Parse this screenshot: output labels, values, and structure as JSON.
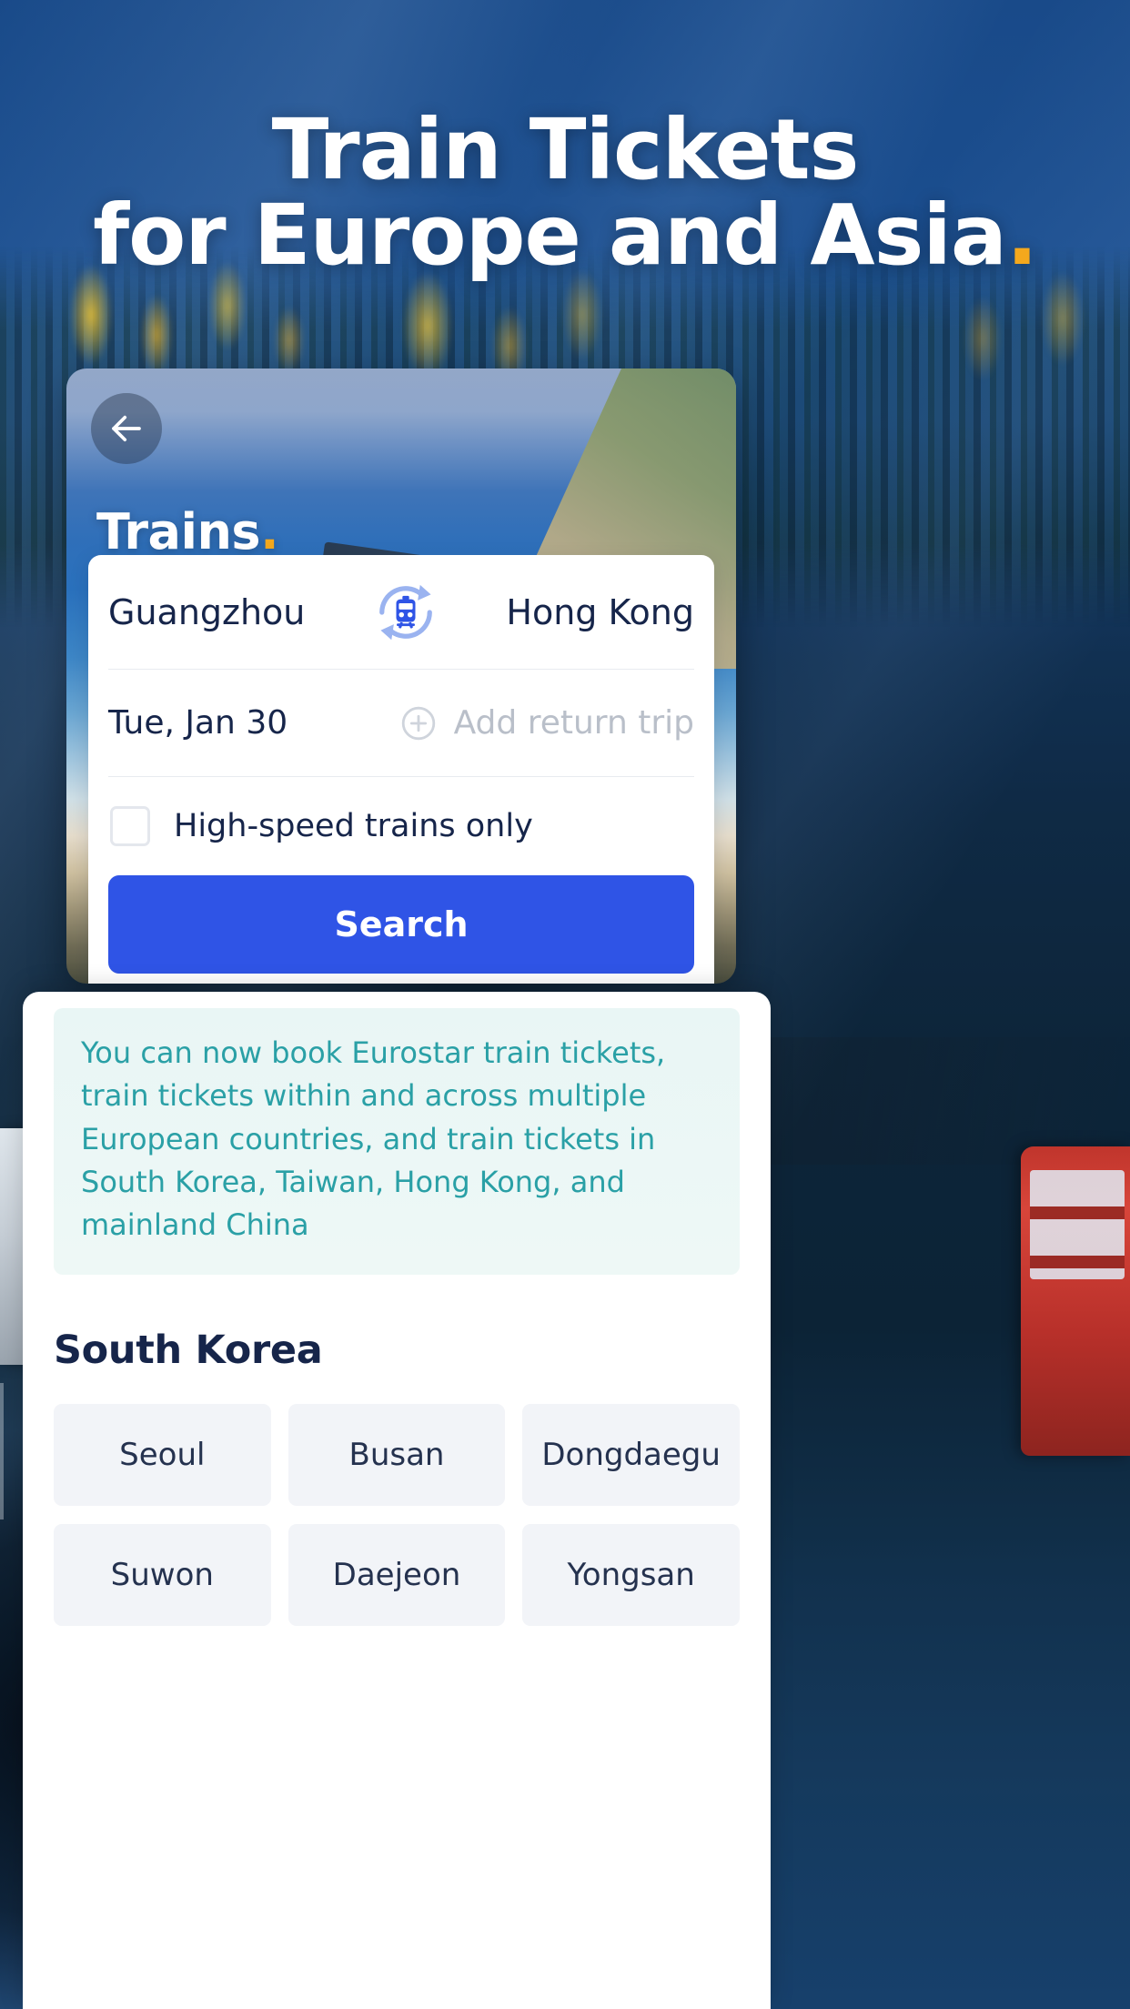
{
  "hero": {
    "line1": "Train Tickets",
    "line2": "for Europe and Asia",
    "accent_dot": ".",
    "accent_color": "#f4a81d"
  },
  "phone": {
    "back_icon": "arrow-left-icon",
    "title": "Trains",
    "title_dot": ".",
    "search_form": {
      "origin": "Guangzhou",
      "destination": "Hong Kong",
      "swap_icon": "train-swap-icon",
      "depart_date": "Tue, Jan 30",
      "add_return_icon": "plus-circle-icon",
      "add_return_label": "Add return trip",
      "highspeed_label": "High-speed trains only",
      "highspeed_checked": false,
      "search_label": "Search",
      "search_button_color": "#2f54e6"
    }
  },
  "sheet": {
    "notice": "You can now book Eurostar train tickets, train tickets within and across multiple European countries, and train tickets in South Korea, Taiwan, Hong Kong, and mainland China",
    "notice_color": "#2aa0a6",
    "section_title": "South Korea",
    "cities": [
      "Seoul",
      "Busan",
      "Dongdaegu",
      "Suwon",
      "Daejeon",
      "Yongsan"
    ]
  }
}
